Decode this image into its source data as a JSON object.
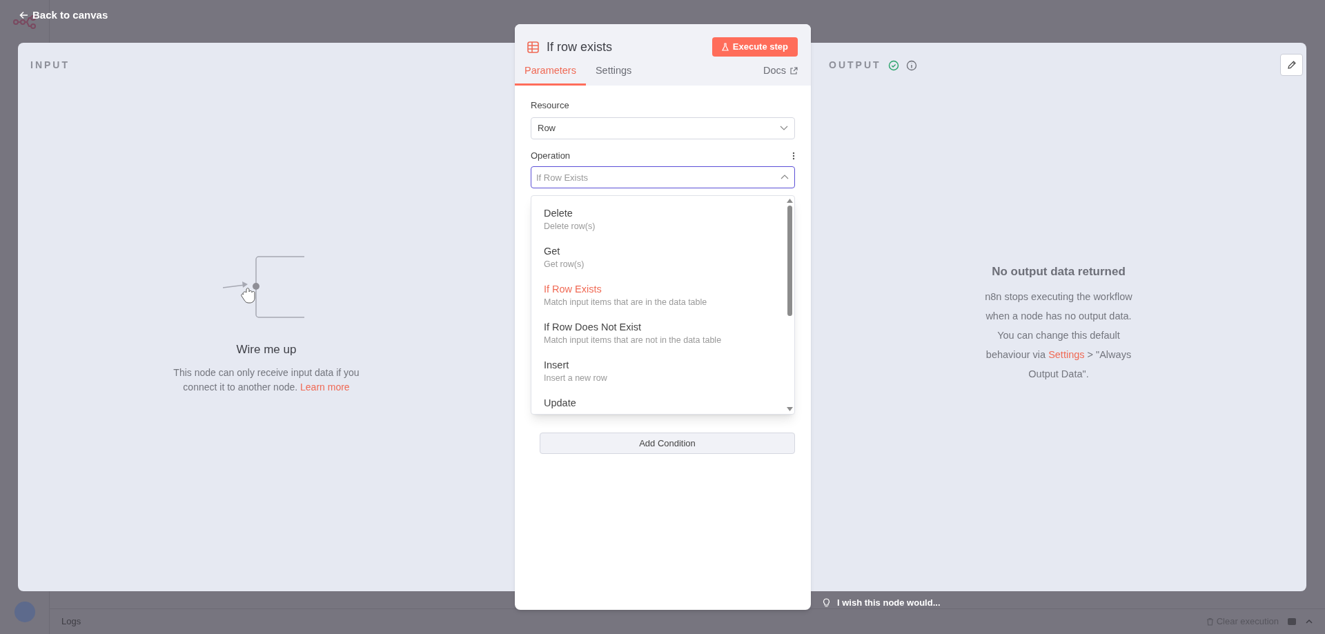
{
  "header": {
    "back_label": "Back to canvas"
  },
  "input_panel": {
    "label": "INPUT",
    "title": "Wire me up",
    "message": "This node can only receive input data if you connect it to another node.",
    "link": "Learn more"
  },
  "node_panel": {
    "title": "If row exists",
    "execute_button": "Execute step",
    "tabs": [
      {
        "label": "Parameters",
        "selected": true
      },
      {
        "label": "Settings",
        "selected": false
      }
    ],
    "docs_link": "Docs",
    "resource": {
      "label": "Resource",
      "value": "Row"
    },
    "operation": {
      "label": "Operation",
      "placeholder": "If Row Exists",
      "expanded": true
    },
    "options": [
      {
        "title": "Delete",
        "description": "Delete row(s)",
        "selected": false
      },
      {
        "title": "Get",
        "description": "Get row(s)",
        "selected": false
      },
      {
        "title": "If Row Exists",
        "description": "Match input items that are in the data table",
        "selected": true
      },
      {
        "title": "If Row Does Not Exist",
        "description": "Match input items that are not in the data table",
        "selected": false
      },
      {
        "title": "Insert",
        "description": "Insert a new row",
        "selected": false
      },
      {
        "title": "Update",
        "selected": false
      }
    ],
    "add_button": "Add Condition"
  },
  "output_panel": {
    "label": "OUTPUT",
    "title": "No output data returned",
    "message_before": "n8n stops executing the workflow when a node has no output data. You can change this default behaviour via",
    "link": "Settings",
    "message_after": "> \"Always Output Data\"."
  },
  "feedback": "I wish this node would...",
  "logs_bar": {
    "label": "Logs",
    "clear_button": "Clear execution"
  }
}
